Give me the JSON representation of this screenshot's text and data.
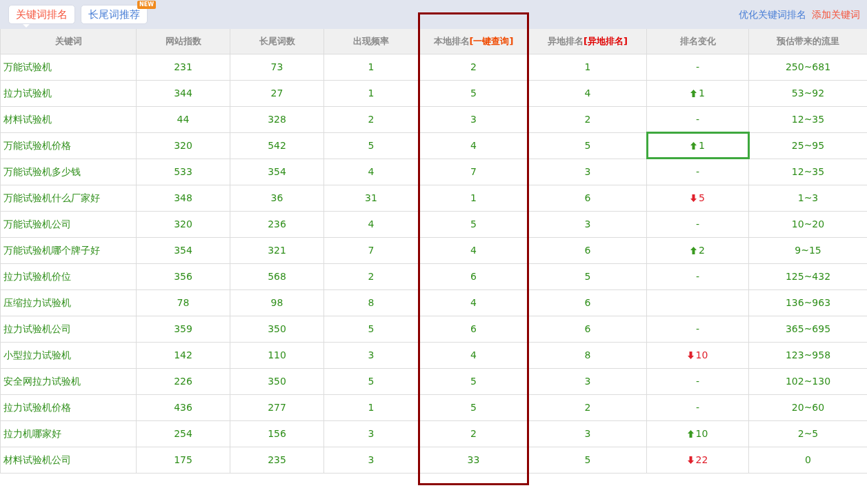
{
  "tabs": [
    {
      "label": "关键词排名",
      "selected": true
    },
    {
      "label": "长尾词推荐",
      "selected": false,
      "badge": "NEW"
    }
  ],
  "links": [
    {
      "label": "优化关键词排名",
      "kind": "primary"
    },
    {
      "label": "添加关键词",
      "kind": "accent"
    }
  ],
  "columns": [
    {
      "label": "关键词"
    },
    {
      "label": "网站指数"
    },
    {
      "label": "长尾词数"
    },
    {
      "label": "出现频率"
    },
    {
      "label": "本地排名",
      "action": "[一键查询]",
      "color": "#f04a00",
      "framed": true
    },
    {
      "label": "异地排名",
      "action": "[异地排名]",
      "color": "#e00000"
    },
    {
      "label": "排名变化"
    },
    {
      "label": "预估带来的流里"
    }
  ],
  "rows": [
    {
      "keyword": "万能试验机",
      "index": "231",
      "longtail": "73",
      "frequency": "1",
      "local_rank": "2",
      "remote_rank": "1",
      "change": {
        "kind": "none",
        "text": "-"
      },
      "traffic": "250~681",
      "selected": false
    },
    {
      "keyword": "拉力试验机",
      "index": "344",
      "longtail": "27",
      "frequency": "1",
      "local_rank": "5",
      "remote_rank": "4",
      "change": {
        "kind": "up",
        "text": "1"
      },
      "traffic": "53~92",
      "selected": false
    },
    {
      "keyword": "材料试验机",
      "index": "44",
      "longtail": "328",
      "frequency": "2",
      "local_rank": "3",
      "remote_rank": "2",
      "change": {
        "kind": "none",
        "text": "-"
      },
      "traffic": "12~35",
      "selected": false
    },
    {
      "keyword": "万能试验机价格",
      "index": "320",
      "longtail": "542",
      "frequency": "5",
      "local_rank": "4",
      "remote_rank": "5",
      "change": {
        "kind": "up",
        "text": "1"
      },
      "traffic": "25~95",
      "selected": true
    },
    {
      "keyword": "万能试验机多少钱",
      "index": "533",
      "longtail": "354",
      "frequency": "4",
      "local_rank": "7",
      "remote_rank": "3",
      "change": {
        "kind": "none",
        "text": "-"
      },
      "traffic": "12~35",
      "selected": false
    },
    {
      "keyword": "万能试验机什么厂家好",
      "index": "348",
      "longtail": "36",
      "frequency": "31",
      "local_rank": "1",
      "remote_rank": "6",
      "change": {
        "kind": "down",
        "text": "5"
      },
      "traffic": "1~3",
      "selected": false
    },
    {
      "keyword": "万能试验机公司",
      "index": "320",
      "longtail": "236",
      "frequency": "4",
      "local_rank": "5",
      "remote_rank": "3",
      "change": {
        "kind": "none",
        "text": "-"
      },
      "traffic": "10~20",
      "selected": false
    },
    {
      "keyword": "万能试验机哪个牌子好",
      "index": "354",
      "longtail": "321",
      "frequency": "7",
      "local_rank": "4",
      "remote_rank": "6",
      "change": {
        "kind": "up",
        "text": "2"
      },
      "traffic": "9~15",
      "selected": false
    },
    {
      "keyword": "拉力试验机价位",
      "index": "356",
      "longtail": "568",
      "frequency": "2",
      "local_rank": "6",
      "remote_rank": "5",
      "change": {
        "kind": "none",
        "text": "-"
      },
      "traffic": "125~432",
      "selected": false
    },
    {
      "keyword": "压缩拉力试验机",
      "index": "78",
      "longtail": "98",
      "frequency": "8",
      "local_rank": "4",
      "remote_rank": "6",
      "traffic": "136~963",
      "selected": false
    },
    {
      "keyword": "拉力试验机公司",
      "index": "359",
      "longtail": "350",
      "frequency": "5",
      "local_rank": "6",
      "remote_rank": "6",
      "change": {
        "kind": "none",
        "text": "-"
      },
      "traffic": "365~695",
      "selected": false
    },
    {
      "keyword": "小型拉力试验机",
      "index": "142",
      "longtail": "110",
      "frequency": "3",
      "local_rank": "4",
      "remote_rank": "8",
      "change": {
        "kind": "down",
        "text": "10"
      },
      "traffic": "123~958",
      "selected": false
    },
    {
      "keyword": "安全网拉力试验机",
      "index": "226",
      "longtail": "350",
      "frequency": "5",
      "local_rank": "5",
      "remote_rank": "3",
      "change": {
        "kind": "none",
        "text": "-"
      },
      "traffic": "102~130",
      "selected": false
    },
    {
      "keyword": "拉力试验机价格",
      "index": "436",
      "longtail": "277",
      "frequency": "1",
      "local_rank": "5",
      "remote_rank": "2",
      "change": {
        "kind": "none",
        "text": "-"
      },
      "traffic": "20~60",
      "selected": false
    },
    {
      "keyword": "拉力机哪家好",
      "index": "254",
      "longtail": "156",
      "frequency": "3",
      "local_rank": "2",
      "remote_rank": "3",
      "change": {
        "kind": "up",
        "text": "10"
      },
      "traffic": "2~5",
      "selected": false
    },
    {
      "keyword": "材料试验机公司",
      "index": "175",
      "longtail": "235",
      "frequency": "3",
      "local_rank": "33",
      "remote_rank": "5",
      "change": {
        "kind": "down",
        "text": "22"
      },
      "traffic": "0",
      "selected": false
    }
  ]
}
